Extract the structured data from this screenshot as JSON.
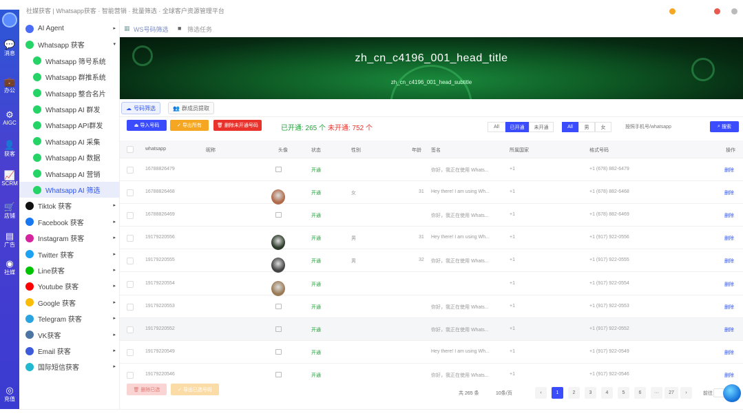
{
  "top": {
    "title": "社媒获客 | Whatsapp获客 · 智能营销 · 批量筛选 · 全球客户资源管理平台"
  },
  "rail": [
    {
      "label": "",
      "icon": "logo-icon"
    },
    {
      "label": "消息",
      "icon": "chat-icon"
    },
    {
      "label": "办公",
      "icon": "briefcase-icon"
    },
    {
      "label": "AIGC",
      "icon": "ai-icon"
    },
    {
      "label": "获客",
      "icon": "user-icon"
    },
    {
      "label": "SCRM",
      "icon": "chart-icon"
    },
    {
      "label": "店铺",
      "icon": "cart-icon"
    },
    {
      "label": "广告",
      "icon": "ad-icon"
    },
    {
      "label": "社媒",
      "icon": "globe-icon"
    },
    {
      "label": "充值",
      "icon": "recharge-icon"
    }
  ],
  "sidebar": [
    {
      "label": "AI Agent",
      "color": "#4a6cf7",
      "arrow": "▸",
      "sub": false
    },
    {
      "label": "Whatsapp 获客",
      "color": "#25d366",
      "arrow": "▾",
      "sub": false
    },
    {
      "label": "Whatsapp 筛号系统",
      "color": "#25d366",
      "arrow": "",
      "sub": true
    },
    {
      "label": "Whatsapp 群推系统",
      "color": "#25d366",
      "arrow": "",
      "sub": true
    },
    {
      "label": "Whatsapp 整合名片",
      "color": "#25d366",
      "arrow": "",
      "sub": true
    },
    {
      "label": "Whatsapp AI 群发",
      "color": "#25d366",
      "arrow": "",
      "sub": true
    },
    {
      "label": "Whatsapp API群发",
      "color": "#25d366",
      "arrow": "",
      "sub": true
    },
    {
      "label": "Whatsapp AI 采集",
      "color": "#25d366",
      "arrow": "",
      "sub": true
    },
    {
      "label": "Whatsapp AI 数据",
      "color": "#25d366",
      "arrow": "",
      "sub": true
    },
    {
      "label": "Whatsapp AI 营销",
      "color": "#25d366",
      "arrow": "",
      "sub": true
    },
    {
      "label": "Whatsapp AI 筛选",
      "color": "#25d366",
      "arrow": "",
      "sub": true,
      "active": true
    },
    {
      "label": "Tiktok 获客",
      "color": "#111111",
      "arrow": "▸",
      "sub": false
    },
    {
      "label": "Facebook 获客",
      "color": "#1877f2",
      "arrow": "▸",
      "sub": false
    },
    {
      "label": "Instagram 获客",
      "color": "#d6249f",
      "arrow": "▸",
      "sub": false
    },
    {
      "label": "Twitter 获客",
      "color": "#1da1f2",
      "arrow": "▸",
      "sub": false
    },
    {
      "label": "Line获客",
      "color": "#00c300",
      "arrow": "▸",
      "sub": false
    },
    {
      "label": "Youtube 获客",
      "color": "#ff0000",
      "arrow": "▸",
      "sub": false
    },
    {
      "label": "Google 获客",
      "color": "#fbbc05",
      "arrow": "▸",
      "sub": false
    },
    {
      "label": "Telegram 获客",
      "color": "#2aa3df",
      "arrow": "▸",
      "sub": false
    },
    {
      "label": "VK获客",
      "color": "#4c75a3",
      "arrow": "▸",
      "sub": false
    },
    {
      "label": "Email 获客",
      "color": "#3b5bdb",
      "arrow": "▸",
      "sub": false
    },
    {
      "label": "国际短信获客",
      "color": "#22b8cf",
      "arrow": "▸",
      "sub": false
    }
  ],
  "tabs": {
    "t1": "WS号码筛选",
    "t2": "筛选任务"
  },
  "hero": {
    "title": "zh_cn_c4196_001_head_title",
    "subtitle": "zh_cn_c4196_001_head_subtitle"
  },
  "subtabs": {
    "a": "号码筛选",
    "b": "群成员提取"
  },
  "toolbar": {
    "import": "导入号码",
    "export": "导出所有",
    "del_unopen": "删除未开通号码",
    "opened": "已开通: 265 个",
    "unopened": "未开通: 752 个",
    "seg1": [
      "All",
      "已开通",
      "未开通"
    ],
    "seg2": [
      "All",
      "男",
      "女"
    ],
    "search_ph": "按照手机号/whatsapp",
    "search_btn": "搜索"
  },
  "colors": {
    "primary": "#3b4cff",
    "green": "#22a038",
    "red": "#e8322b",
    "orange": "#f5a623"
  },
  "table": {
    "headers": [
      "whatsapp",
      "昵称",
      "头像",
      "状态",
      "性别",
      "年龄",
      "签名",
      "所属国家",
      "格式号码",
      "操作"
    ],
    "rows": [
      {
        "wa": "16788826479",
        "nick": "",
        "avatar": "none",
        "status": "开通",
        "gender": "",
        "age": "",
        "sign": "你好，我正在使用 Whats...",
        "country": "+1",
        "fmt": "+1 (678) 882-6479",
        "op": "删除"
      },
      {
        "wa": "16788826468",
        "nick": "",
        "avatar": "#b06a4a",
        "status": "开通",
        "gender": "女",
        "age": "31",
        "sign": "Hey there! I am using Wh...",
        "country": "+1",
        "fmt": "+1 (678) 882-6468",
        "op": "删除"
      },
      {
        "wa": "16788826469",
        "nick": "",
        "avatar": "none",
        "status": "开通",
        "gender": "",
        "age": "",
        "sign": "你好，我正在使用 Whats...",
        "country": "+1",
        "fmt": "+1 (678) 882-6469",
        "op": "删除"
      },
      {
        "wa": "19179220556",
        "nick": "",
        "avatar": "#2d3b2a",
        "status": "开通",
        "gender": "男",
        "age": "31",
        "sign": "Hey there! I am using Wh...",
        "country": "+1",
        "fmt": "+1 (917) 922-0556",
        "op": "删除"
      },
      {
        "wa": "19179220555",
        "nick": "",
        "avatar": "#444444",
        "status": "开通",
        "gender": "男",
        "age": "32",
        "sign": "你好，我正在使用 Whats...",
        "country": "+1",
        "fmt": "+1 (917) 922-0555",
        "op": "删除"
      },
      {
        "wa": "19179220554",
        "nick": "",
        "avatar": "#9a7a55",
        "status": "开通",
        "gender": "",
        "age": "",
        "sign": "",
        "country": "+1",
        "fmt": "+1 (917) 922-0554",
        "op": "删除"
      },
      {
        "wa": "19179220553",
        "nick": "",
        "avatar": "none",
        "status": "开通",
        "gender": "",
        "age": "",
        "sign": "你好，我正在使用 Whats...",
        "country": "+1",
        "fmt": "+1 (917) 922-0553",
        "op": "删除"
      },
      {
        "wa": "19179220552",
        "nick": "",
        "avatar": "none",
        "status": "开通",
        "gender": "",
        "age": "",
        "sign": "你好，我正在使用 Whats...",
        "country": "+1",
        "fmt": "+1 (917) 922-0552",
        "op": "删除",
        "hl": true
      },
      {
        "wa": "19179220549",
        "nick": "",
        "avatar": "none",
        "status": "开通",
        "gender": "",
        "age": "",
        "sign": "Hey there! I am using Wh...",
        "country": "+1",
        "fmt": "+1 (917) 922-0549",
        "op": "删除"
      },
      {
        "wa": "19179220546",
        "nick": "",
        "avatar": "none",
        "status": "开通",
        "gender": "",
        "age": "",
        "sign": "你好，我正在使用 Whats...",
        "country": "+1",
        "fmt": "+1 (917) 922-0546",
        "op": "删除"
      }
    ]
  },
  "footer": {
    "del_selected": "删除已选",
    "export_selected": "导出已选号码",
    "total": "共 265 条",
    "per_page": "10条/页",
    "pages": [
      "‹",
      "1",
      "2",
      "3",
      "4",
      "5",
      "6",
      "···",
      "27",
      "›"
    ],
    "goto": "前往"
  }
}
